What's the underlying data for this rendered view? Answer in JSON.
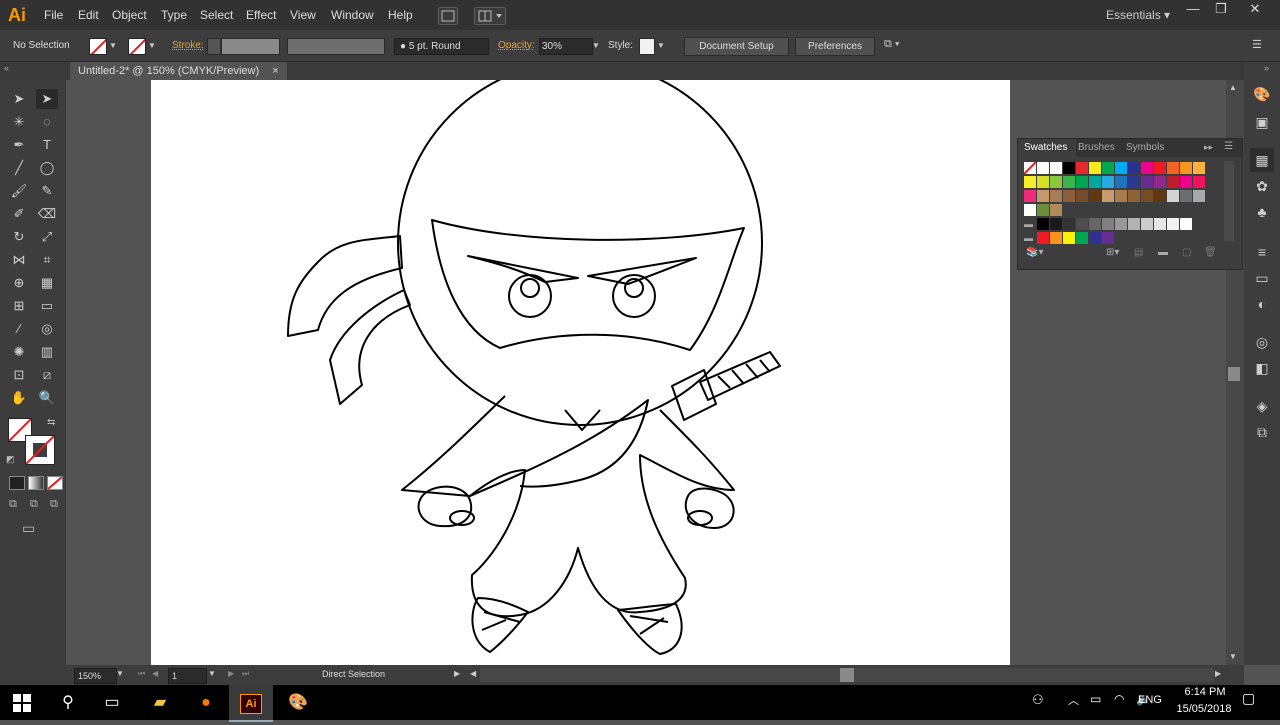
{
  "app": {
    "logo": "Ai"
  },
  "menu": [
    "File",
    "Edit",
    "Object",
    "Type",
    "Select",
    "Effect",
    "View",
    "Window",
    "Help"
  ],
  "workspace": "Essentials",
  "control": {
    "selection": "No Selection",
    "stroke_label": "Stroke:",
    "brush": "5 pt. Round",
    "opacity_label": "Opacity:",
    "opacity_value": "30%",
    "style_label": "Style:",
    "document_setup": "Document Setup",
    "preferences": "Preferences"
  },
  "document": {
    "tab_title": "Untitled-2* @ 150% (CMYK/Preview)",
    "close": "×"
  },
  "swatches_panel": {
    "tabs": [
      "Swatches",
      "Brushes",
      "Symbols"
    ],
    "rows": [
      [
        "none",
        "#ffffff",
        "#ffffff",
        "#000000",
        "#e8262d",
        "#f6ea1c",
        "#00a650",
        "#00aeef",
        "#2e3191",
        "#ec008c",
        "#ed1c24",
        "#f26522",
        "#f7941d",
        "#fbb040"
      ],
      [
        "#f8ed28",
        "#d7df23",
        "#8dc63f",
        "#39b54a",
        "#00a651",
        "#00a79d",
        "#27aae1",
        "#1c75bc",
        "#2b3990",
        "#662d91",
        "#92278f",
        "#be1e2d",
        "#ec008c",
        "#ed145b"
      ],
      [
        "#ee2a7b",
        "#c49a6c",
        "#a67c52",
        "#8b5e3c",
        "#754c29",
        "#603913",
        "#c69c6d",
        "#a97c50",
        "#8c6239",
        "#754c24",
        "#603913",
        "#d1d3d4",
        "#6d6e71",
        "#a7a9ac"
      ],
      [
        "#ffffff",
        "#6a8f3a",
        "#b08a5a"
      ],
      [
        "#000000",
        "#1a1a1a",
        "#333333",
        "#4d4d4d",
        "#666666",
        "#808080",
        "#999999",
        "#b3b3b3",
        "#cccccc",
        "#e6e6e6",
        "#f2f2f2",
        "#ffffff"
      ],
      [
        "#ed1c24",
        "#f7941d",
        "#fff200",
        "#00a651",
        "#2e3192",
        "#662d91"
      ]
    ]
  },
  "status": {
    "zoom": "150%",
    "page": "1",
    "tool": "Direct Selection"
  },
  "taskbar": {
    "language": "ENG",
    "time": "6:14 PM",
    "date": "15/05/2018"
  }
}
